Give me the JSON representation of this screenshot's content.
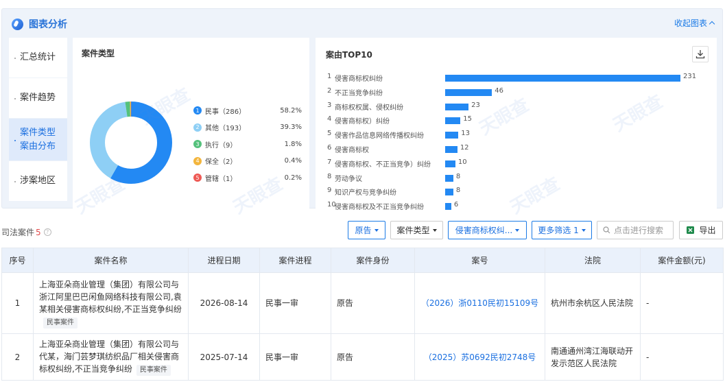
{
  "analysis": {
    "title": "图表分析",
    "collapse_label": "收起图表",
    "side_tabs": [
      {
        "label": "汇总统计"
      },
      {
        "label": "案件趋势"
      },
      {
        "label": "案件类型\n案由分布"
      },
      {
        "label": "涉案地区"
      }
    ],
    "watermark": "天眼查"
  },
  "case_type_card": {
    "title": "案件类型",
    "legend": [
      {
        "num": "1",
        "name": "民事（286）",
        "pct": "58.2%",
        "color": "#2389f3"
      },
      {
        "num": "2",
        "name": "其他（193）",
        "pct": "39.3%",
        "color": "#8ecff5"
      },
      {
        "num": "3",
        "name": "执行（9）",
        "pct": "1.8%",
        "color": "#54c17c"
      },
      {
        "num": "4",
        "name": "保全（2）",
        "pct": "0.4%",
        "color": "#f3b53d"
      },
      {
        "num": "5",
        "name": "管辖（1）",
        "pct": "0.2%",
        "color": "#ee5a55"
      }
    ]
  },
  "top_card": {
    "title": "案由TOP10",
    "bars": [
      {
        "rank": "1",
        "label": "侵害商标权纠纷",
        "value": 231
      },
      {
        "rank": "2",
        "label": "不正当竞争纠纷",
        "value": 46
      },
      {
        "rank": "3",
        "label": "商标权权属、侵权纠纷",
        "value": 23
      },
      {
        "rank": "4",
        "label": "侵害商标权）纠纷",
        "value": 15
      },
      {
        "rank": "5",
        "label": "侵害作品信息网络传播权纠纷",
        "value": 13
      },
      {
        "rank": "6",
        "label": "侵害商标权",
        "value": 12
      },
      {
        "rank": "7",
        "label": "侵害商标权、不正当竞争）纠纷",
        "value": 10
      },
      {
        "rank": "8",
        "label": "劳动争议",
        "value": 8
      },
      {
        "rank": "9",
        "label": "知识产权与竞争纠纷",
        "value": 8
      },
      {
        "rank": "10",
        "label": "侵害商标权及不正当竞争纠纷",
        "value": 6
      }
    ]
  },
  "chart_data": [
    {
      "type": "pie",
      "title": "案件类型",
      "categories": [
        "民事",
        "其他",
        "执行",
        "保全",
        "管辖"
      ],
      "values": [
        286,
        193,
        9,
        2,
        1
      ],
      "percent": [
        58.2,
        39.3,
        1.8,
        0.4,
        0.2
      ],
      "colors": [
        "#2389f3",
        "#8ecff5",
        "#54c17c",
        "#f3b53d",
        "#ee5a55"
      ],
      "legend": "right"
    },
    {
      "type": "bar",
      "title": "案由TOP10",
      "orientation": "horizontal",
      "categories": [
        "侵害商标权纠纷",
        "不正当竞争纠纷",
        "商标权权属、侵权纠纷",
        "侵害商标权）纠纷",
        "侵害作品信息网络传播权纠纷",
        "侵害商标权",
        "侵害商标权、不正当竞争）纠纷",
        "劳动争议",
        "知识产权与竞争纠纷",
        "侵害商标权及不正当竞争纠纷"
      ],
      "values": [
        231,
        46,
        23,
        15,
        13,
        12,
        10,
        8,
        8,
        6
      ],
      "color": "#2389f3"
    }
  ],
  "toolbar": {
    "title": "司法案件",
    "count": "5",
    "filters": [
      {
        "label": "原告",
        "style": "active"
      },
      {
        "label": "案件类型",
        "style": "plain"
      },
      {
        "label": "侵害商标权纠...",
        "style": "active"
      },
      {
        "label": "更多筛选 1",
        "style": "active"
      }
    ],
    "search_placeholder": "点击进行搜索",
    "export_label": "导出"
  },
  "table": {
    "headers": [
      "序号",
      "案件名称",
      "进程日期",
      "案件进程",
      "案件身份",
      "案号",
      "法院",
      "案件金额(元)"
    ],
    "rows": [
      {
        "index": "1",
        "name": "上海亚朵商业管理（集团）有限公司与浙江阿里巴巴闲鱼网络科技有限公司,袁某相关侵害商标权纠纷,不正当竞争纠纷",
        "tag": "民事案件",
        "date": "2026-08-14",
        "stage": "民事一审",
        "role": "原告",
        "case_no": "（2026）浙0110民初15109号",
        "court": "杭州市余杭区人民法院",
        "amount": "-"
      },
      {
        "index": "2",
        "name": "上海亚朵商业管理（集团）有限公司与代某，海门芸梦琪纺织品厂相关侵害商标权纠纷,不正当竞争纠纷",
        "tag": "民事案件",
        "date": "2025-07-14",
        "stage": "民事一审",
        "role": "原告",
        "case_no": "（2025）苏0692民初2748号",
        "court": "南通通州湾江海联动开发示范区人民法院",
        "amount": "-"
      }
    ]
  }
}
